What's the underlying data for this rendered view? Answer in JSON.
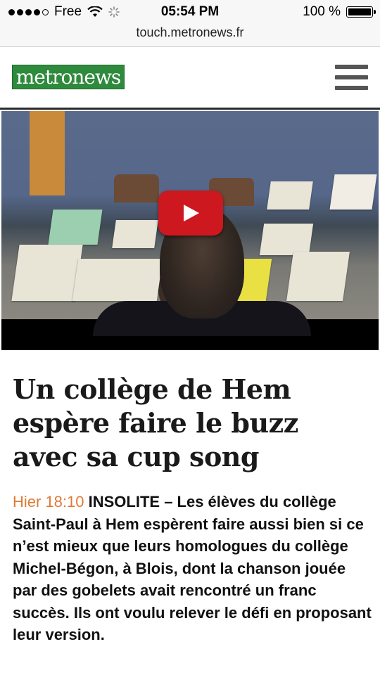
{
  "status_bar": {
    "carrier": "Free",
    "time": "05:54 PM",
    "battery_percent": "100 %",
    "signal_bars": 4,
    "signal_total": 5
  },
  "browser": {
    "url": "touch.metronews.fr"
  },
  "header": {
    "logo_text": "metronews",
    "logo_color": "#2e8a3c"
  },
  "video": {
    "player": "YouTube",
    "play_button_color": "#cc181e"
  },
  "article": {
    "headline": "Un collège de Hem espère faire le buzz avec sa cup song",
    "timestamp": "Hier 18:10",
    "category_and_text": " INSOLITE – Les élèves du collège Saint-Paul à Hem espèrent faire aussi bien si ce n’est mieux que leurs homologues du collège Michel-Bégon, à Blois, dont la chanson jouée par des gobelets avait rencontré un franc succès. Ils ont voulu relever le défi en proposant leur version.",
    "timestamp_color": "#e07a35"
  }
}
